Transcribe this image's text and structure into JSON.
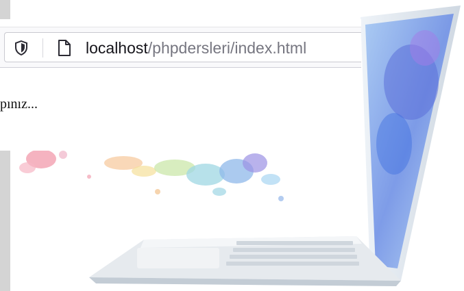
{
  "browser": {
    "address_bar": {
      "host": "localhost",
      "path": "/phpdersleri/index.html",
      "left_icon": "shield-icon",
      "page_icon": "page-icon"
    },
    "content_text": "pınız..."
  },
  "colors": {
    "left_strip": "#d4d4d4",
    "url_host": "#15141a",
    "url_path": "#767680"
  }
}
